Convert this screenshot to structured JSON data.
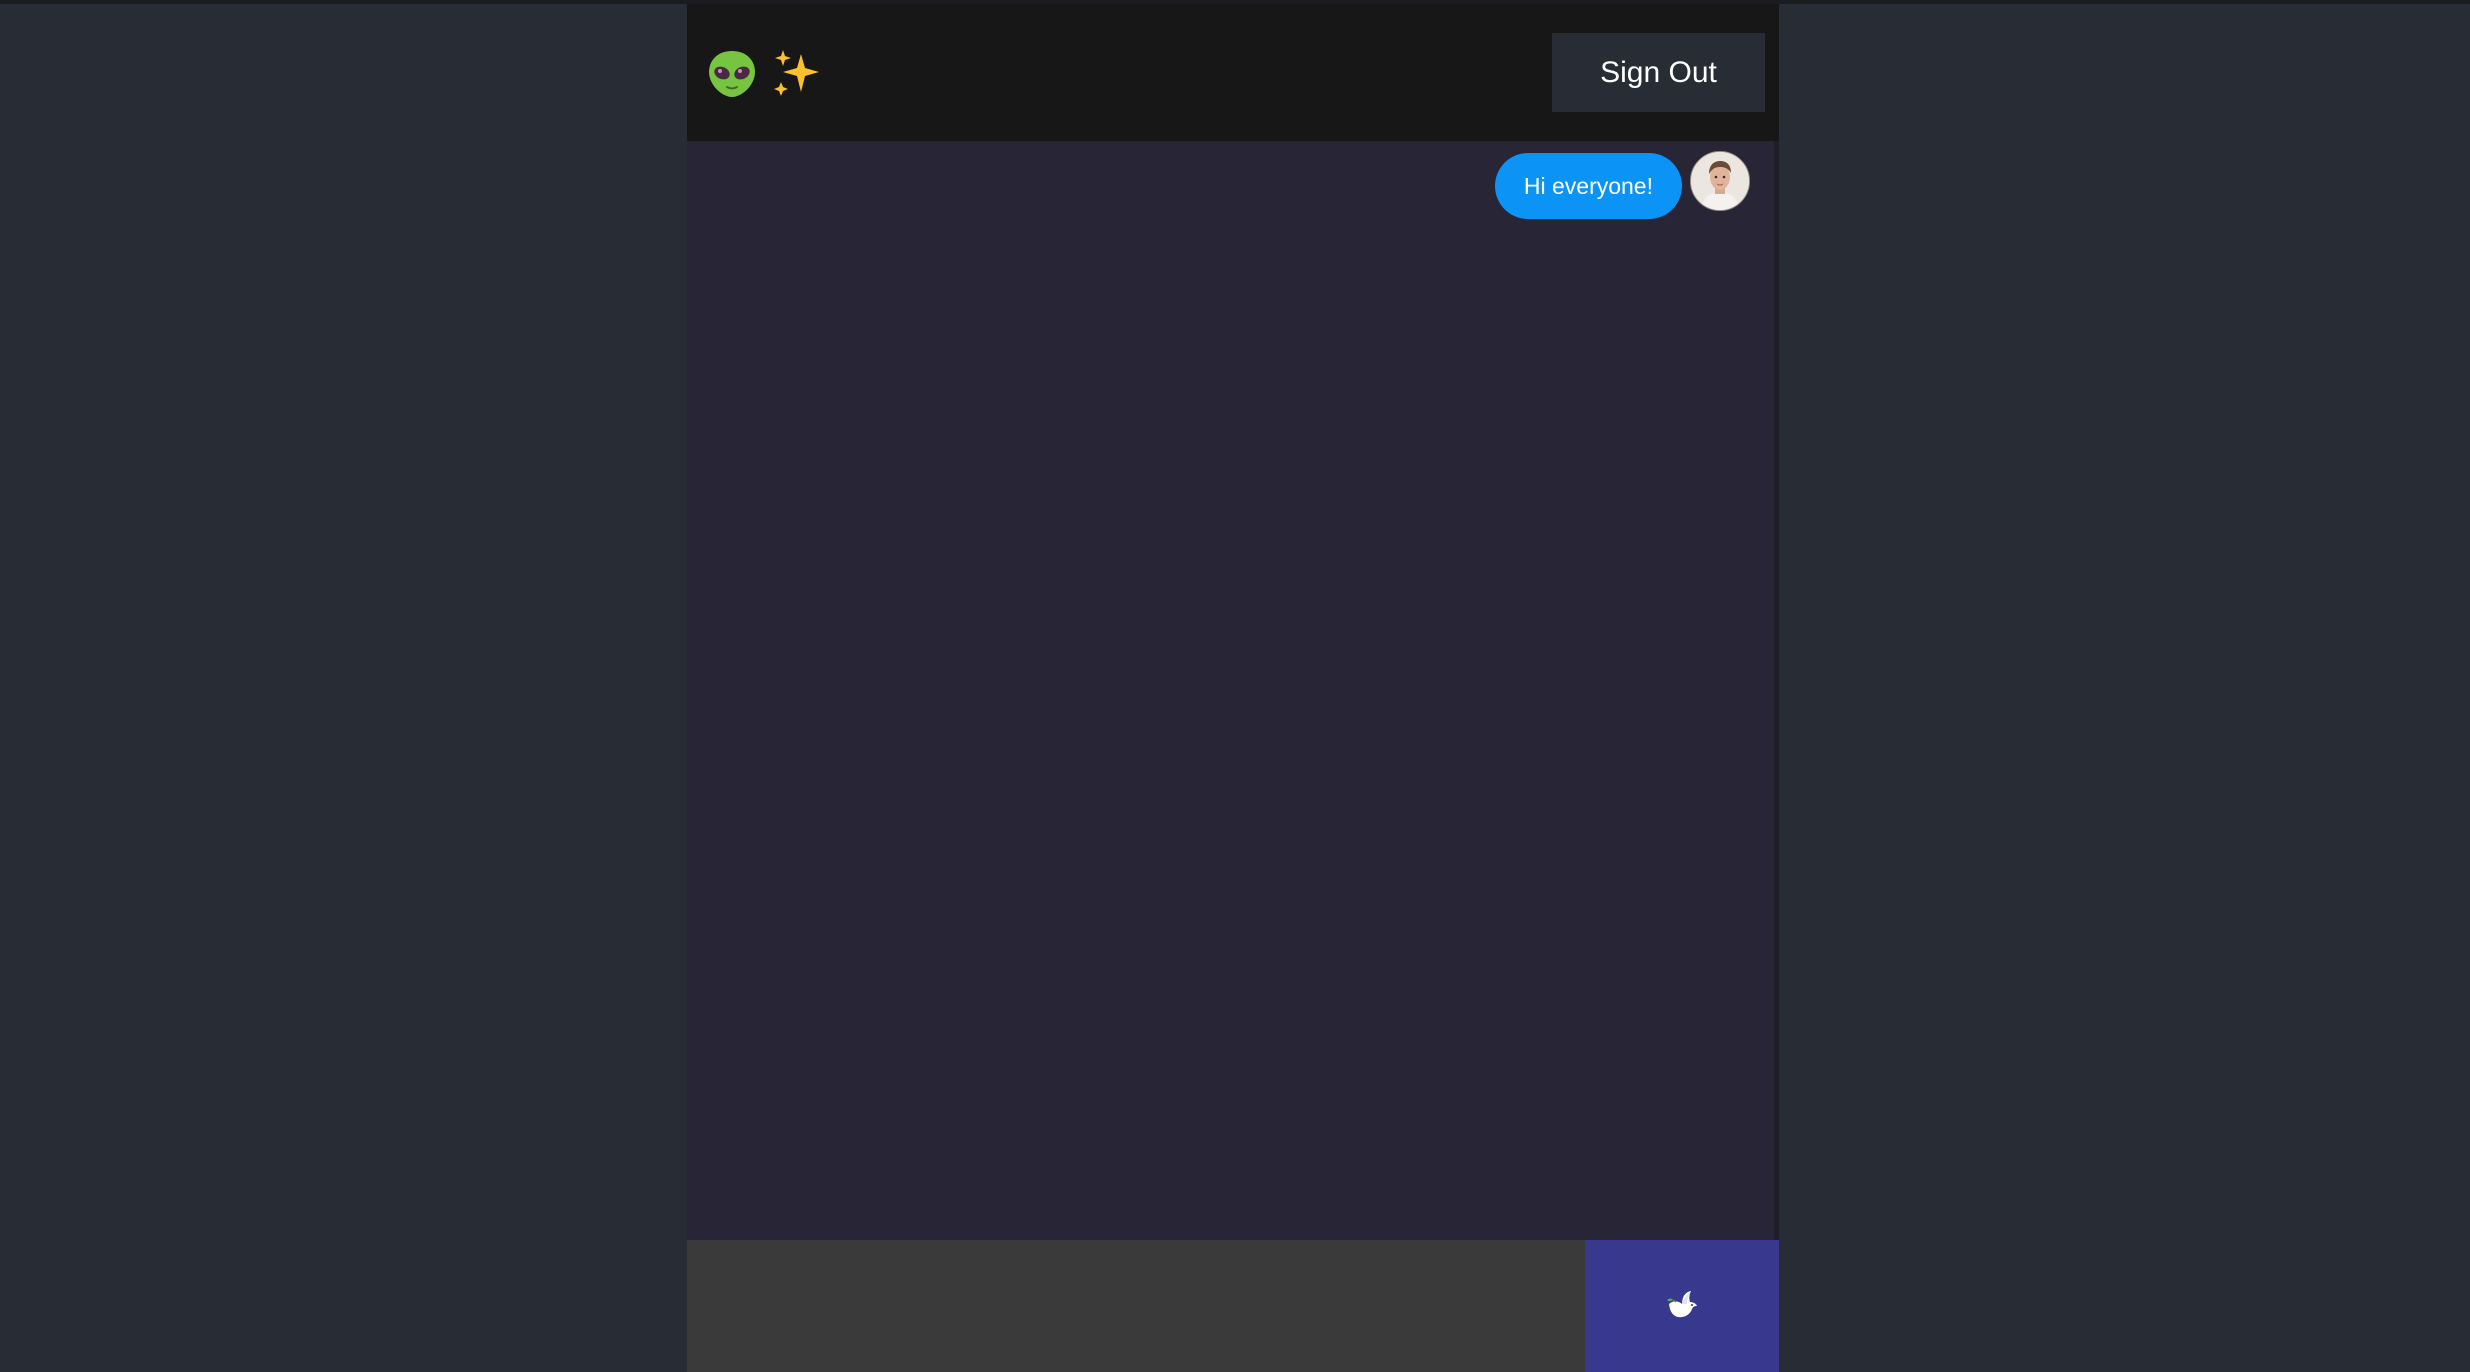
{
  "header": {
    "logo_icons": [
      "alien-icon",
      "sparkles-icon"
    ],
    "sign_out_label": "Sign Out"
  },
  "messages": [
    {
      "text": "Hi everyone!",
      "direction": "sent",
      "avatar_icon": "user-avatar"
    }
  ],
  "composer": {
    "input_value": "",
    "input_placeholder": "",
    "send_icon": "dove-icon"
  },
  "colors": {
    "page_background": "#282c34",
    "header_background": "#181717",
    "sign_out_background": "#282c34",
    "chat_background": "#282537",
    "sent_bubble": "#0b93f6",
    "input_background": "#3a3a3a",
    "send_button": "#38388f"
  }
}
